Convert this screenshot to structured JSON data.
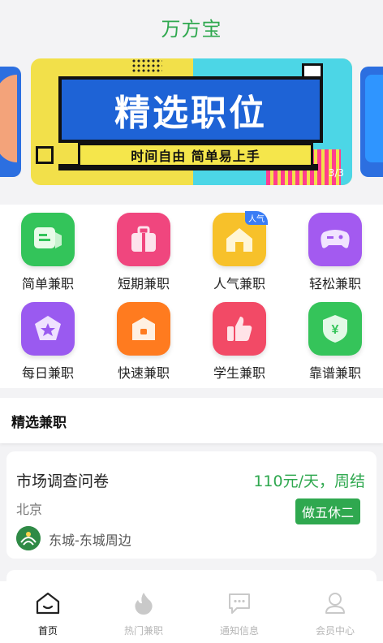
{
  "header": {
    "title": "万方宝"
  },
  "banner": {
    "headline": "精选职位",
    "subline": "时间自由  简单易上手",
    "pager": "3/3"
  },
  "categories": [
    {
      "label": "简单兼职",
      "icon": "chat-icon",
      "color": "#33c45a"
    },
    {
      "label": "短期兼职",
      "icon": "bag-icon",
      "color": "#f0467e"
    },
    {
      "label": "人气兼职",
      "icon": "home-icon",
      "color": "#f7c12a",
      "badge": "人气"
    },
    {
      "label": "轻松兼职",
      "icon": "gamepad-icon",
      "color": "#a35af0"
    },
    {
      "label": "每日兼职",
      "icon": "star-pentagon-icon",
      "color": "#9a5af0"
    },
    {
      "label": "快速兼职",
      "icon": "box-icon",
      "color": "#ff7b1f"
    },
    {
      "label": "学生兼职",
      "icon": "thumbs-up-icon",
      "color": "#f24a66"
    },
    {
      "label": "靠谱兼职",
      "icon": "shield-yen-icon",
      "color": "#35c45a"
    }
  ],
  "section": {
    "title": "精选兼职"
  },
  "job": {
    "title": "市场调查问卷",
    "salary": "110元/天，周结",
    "city": "北京",
    "tag": "做五休二",
    "location": "东城-东城周边"
  },
  "tabs": [
    {
      "label": "首页",
      "icon": "home-outline-icon",
      "active": true
    },
    {
      "label": "热门兼职",
      "icon": "flame-icon",
      "active": false
    },
    {
      "label": "通知信息",
      "icon": "message-icon",
      "active": false
    },
    {
      "label": "会员中心",
      "icon": "user-icon",
      "active": false
    }
  ],
  "colors": {
    "accent": "#2fa84f"
  }
}
